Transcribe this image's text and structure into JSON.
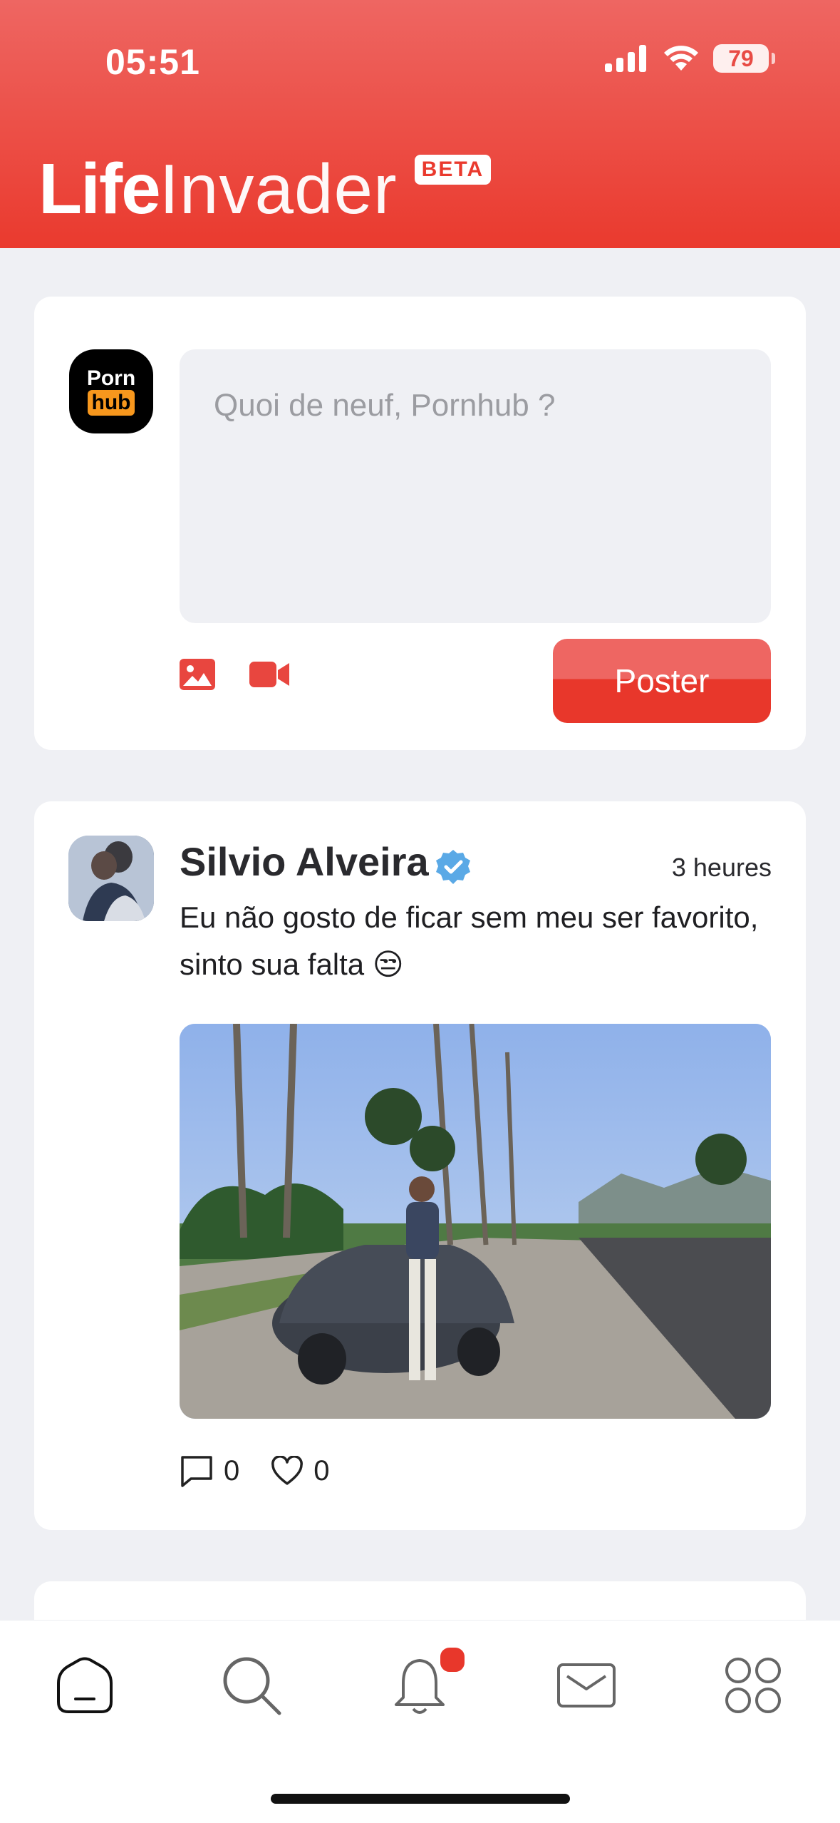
{
  "status_bar": {
    "time": "05:51",
    "battery": "79"
  },
  "header": {
    "brand_bold": "Life",
    "brand_light": "Invader",
    "badge": "BETA"
  },
  "composer": {
    "avatar_text_top": "Porn",
    "avatar_text_bottom": "hub",
    "placeholder": "Quoi de neuf, Pornhub ?",
    "icons": [
      "image-icon",
      "video-icon"
    ],
    "post_button": "Poster"
  },
  "feed": {
    "posts": [
      {
        "author": "Silvio Alveira",
        "verified": true,
        "time": "3 heures",
        "text": "Eu não gosto de ficar sem meu ser favorito, sinto sua falta 😒",
        "comments": "0",
        "likes": "0"
      }
    ]
  },
  "tabbar": {
    "items": [
      "home-icon",
      "search-icon",
      "bell-icon",
      "mail-icon",
      "apps-icon"
    ],
    "notification_dot_color": "#e8372b"
  },
  "colors": {
    "accent": "#ea3a2e",
    "verified": "#5aa9e6"
  }
}
